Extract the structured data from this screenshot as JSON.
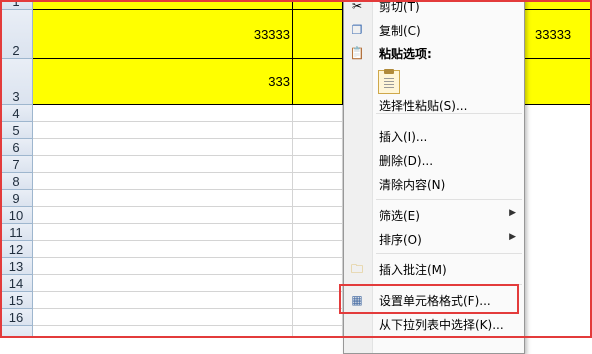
{
  "sheet": {
    "rows": [
      {
        "num": "1"
      },
      {
        "num": "2",
        "cells": [
          "33333",
          "",
          "33333"
        ]
      },
      {
        "num": "3",
        "cells": [
          "333"
        ]
      },
      {
        "num": "4"
      },
      {
        "num": "5"
      },
      {
        "num": "6"
      },
      {
        "num": "7"
      },
      {
        "num": "8"
      },
      {
        "num": "9"
      },
      {
        "num": "10"
      },
      {
        "num": "11"
      },
      {
        "num": "12"
      },
      {
        "num": "13"
      },
      {
        "num": "14"
      },
      {
        "num": "15"
      },
      {
        "num": "16"
      }
    ],
    "highlight_color": "#ffff00"
  },
  "context_menu": {
    "cut": "剪切(T)",
    "copy": "复制(C)",
    "paste_options": "粘贴选项:",
    "paste_special": "选择性粘贴(S)...",
    "insert": "插入(I)...",
    "delete": "删除(D)...",
    "clear_contents": "清除内容(N)",
    "filter": "筛选(E)",
    "sort": "排序(O)",
    "insert_comment": "插入批注(M)",
    "format_cells": "设置单元格格式(F)...",
    "pick_from_list": "从下拉列表中选择(K)...",
    "submenu_arrow": "▶",
    "icons": {
      "cut": "scissors-icon",
      "copy": "copy-icon",
      "paste": "clipboard-icon",
      "comment": "folder-comment-icon",
      "format": "format-cells-icon"
    }
  },
  "annotation_color": "#e33b3b"
}
